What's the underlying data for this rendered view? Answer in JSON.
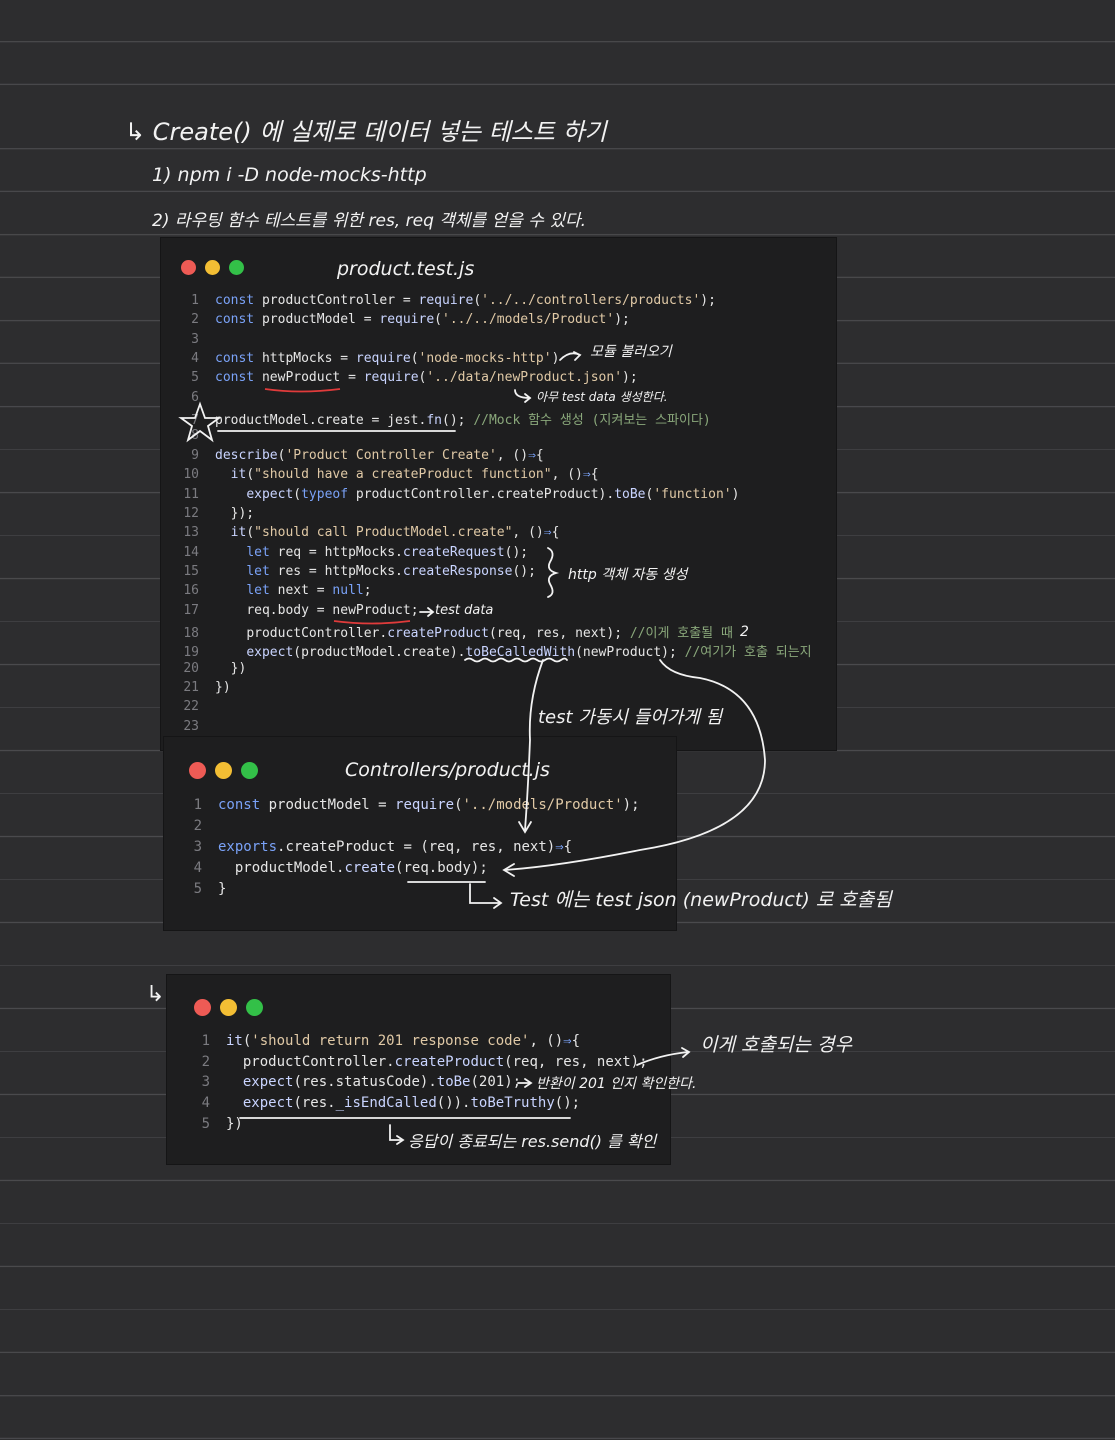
{
  "notes": {
    "heading": "↳ Create() 에 실제로 데이터 넣는 테스트 하기",
    "step1": "1) npm i -D node-mocks-http",
    "step2": "2) 라우팅 함수 테스트를 위한 res, req 객체를 얻을 수 있다.",
    "arrow_marker": "↳"
  },
  "win1": {
    "title": "product.test.js",
    "lines": [
      {
        "n": "1",
        "t": "const productController = require('../../controllers/products');"
      },
      {
        "n": "2",
        "t": "const productModel = require('../../models/Product');"
      },
      {
        "n": "3",
        "t": ""
      },
      {
        "n": "4",
        "t": "const httpMocks = require('node-mocks-http')"
      },
      {
        "n": "5",
        "t": "const newProduct = require('../data/newProduct.json');"
      },
      {
        "n": "6",
        "t": ""
      },
      {
        "n": "7",
        "t": "productModel.create = jest.fn(); //Mock 함수 생성 (지켜보는 스파이다)"
      },
      {
        "n": "8",
        "t": ""
      },
      {
        "n": "9",
        "t": "describe('Product Controller Create', ()=>{"
      },
      {
        "n": "10",
        "t": "  it(\"should have a createProduct function\", ()=>{"
      },
      {
        "n": "11",
        "t": "    expect(typeof productController.createProduct).toBe('function')"
      },
      {
        "n": "12",
        "t": "  });"
      },
      {
        "n": "13",
        "t": "  it(\"should call ProductModel.create\", ()=>{"
      },
      {
        "n": "14",
        "t": "    let req = httpMocks.createRequest();"
      },
      {
        "n": "15",
        "t": "    let res = httpMocks.createResponse();"
      },
      {
        "n": "16",
        "t": "    let next = null;"
      },
      {
        "n": "17",
        "t": "    req.body = newProduct;"
      },
      {
        "n": "18",
        "t": "    productController.createProduct(req, res, next); //이게 호출될 때"
      },
      {
        "n": "19",
        "t": "    expect(productModel.create).toBeCalledWith(newProduct); //여기가 호출 되는지"
      },
      {
        "n": "20",
        "t": "  })"
      },
      {
        "n": "21",
        "t": "})"
      },
      {
        "n": "22",
        "t": ""
      },
      {
        "n": "23",
        "t": ""
      }
    ],
    "annotations": {
      "module_load": "모듈 불러오기",
      "test_data": "아무 test data 생성한다.",
      "http_auto": "http 객체 자동 생성",
      "req_body": "test data",
      "then": "2",
      "test_run": "test 가동시 들어가게 됨"
    }
  },
  "win2": {
    "title": "Controllers/product.js",
    "lines": [
      {
        "n": "1",
        "t": "const productModel = require('../models/Product');"
      },
      {
        "n": "2",
        "t": ""
      },
      {
        "n": "3",
        "t": "exports.createProduct = (req, res, next)=>{"
      },
      {
        "n": "4",
        "t": "  productModel.create(req.body);"
      },
      {
        "n": "5",
        "t": "}"
      }
    ],
    "annotation": "Test 에는 test json (newProduct) 로 호출됨"
  },
  "win3": {
    "lines": [
      {
        "n": "1",
        "t": "it('should return 201 response code', ()=>{"
      },
      {
        "n": "2",
        "t": "  productController.createProduct(req, res, next);"
      },
      {
        "n": "3",
        "t": "  expect(res.statusCode).toBe(201);"
      },
      {
        "n": "4",
        "t": "  expect(res._isEndCalled()).toBeTruthy();"
      },
      {
        "n": "5",
        "t": "})"
      }
    ],
    "annotations": {
      "called_case": "이게 호출되는 경우",
      "check_201": "반환이 201 인지 확인한다.",
      "res_send": "응답이 종료되는 res.send() 를 확인"
    }
  }
}
